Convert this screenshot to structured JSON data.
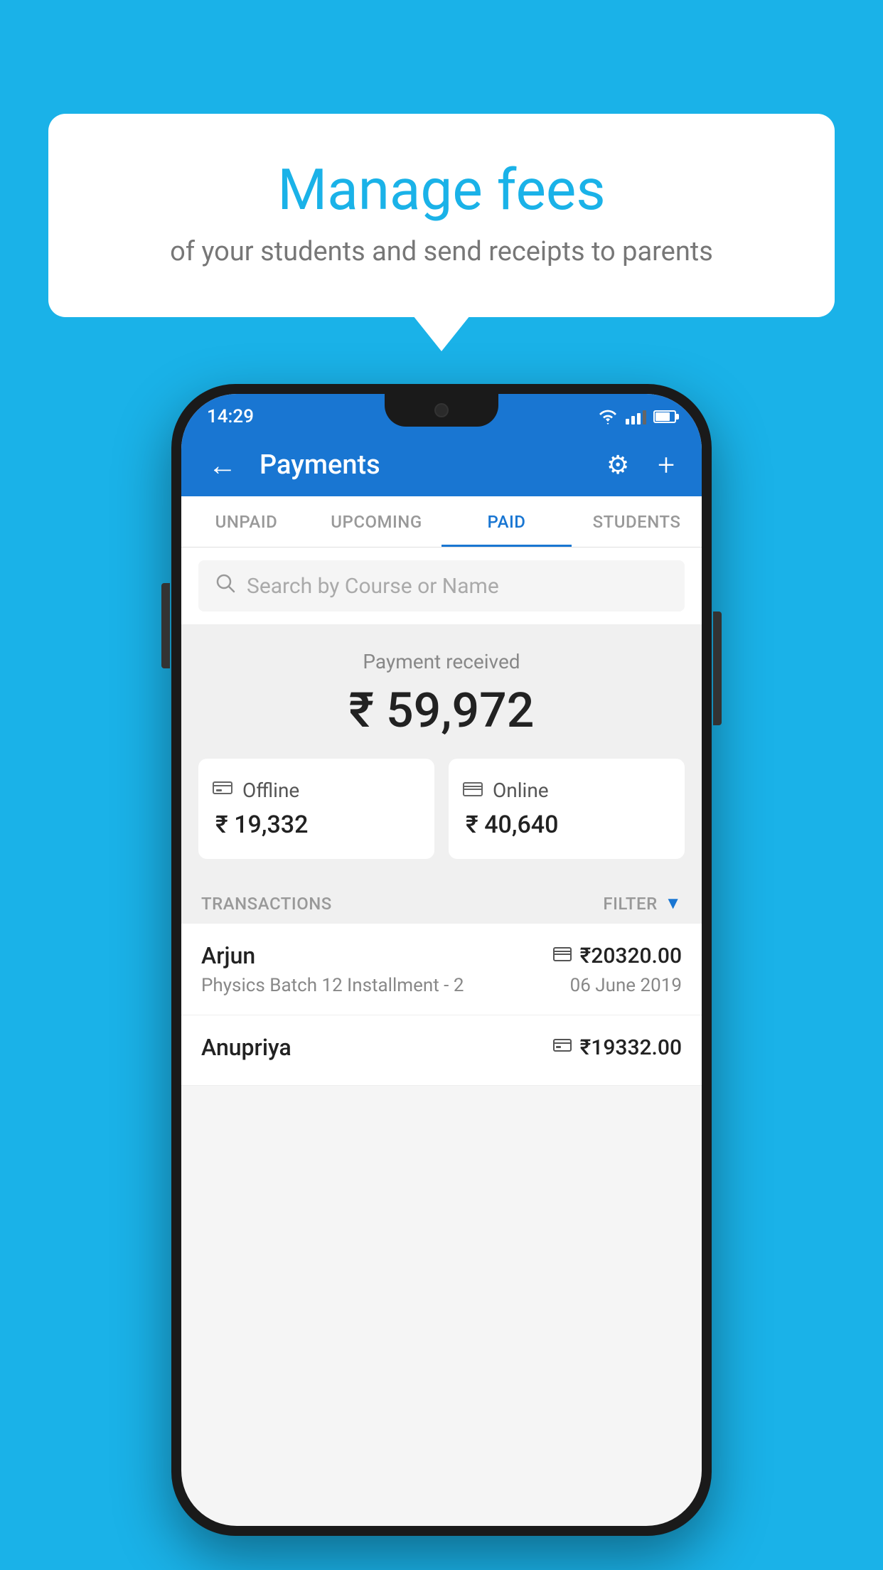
{
  "background_color": "#1ab2e8",
  "bubble": {
    "title": "Manage fees",
    "subtitle": "of your students and send receipts to parents"
  },
  "status_bar": {
    "time": "14:29"
  },
  "app_bar": {
    "title": "Payments",
    "back_label": "←",
    "settings_label": "⚙",
    "add_label": "+"
  },
  "tabs": [
    {
      "label": "UNPAID",
      "active": false
    },
    {
      "label": "UPCOMING",
      "active": false
    },
    {
      "label": "PAID",
      "active": true
    },
    {
      "label": "STUDENTS",
      "active": false
    }
  ],
  "search": {
    "placeholder": "Search by Course or Name"
  },
  "payment_summary": {
    "label": "Payment received",
    "total": "₹ 59,972",
    "offline_label": "Offline",
    "offline_amount": "₹ 19,332",
    "online_label": "Online",
    "online_amount": "₹ 40,640"
  },
  "transactions": {
    "header_label": "TRANSACTIONS",
    "filter_label": "FILTER",
    "rows": [
      {
        "name": "Arjun",
        "course": "Physics Batch 12 Installment - 2",
        "amount": "₹20320.00",
        "date": "06 June 2019",
        "icon": "card"
      },
      {
        "name": "Anupriya",
        "course": "",
        "amount": "₹19332.00",
        "date": "",
        "icon": "offline"
      }
    ]
  }
}
